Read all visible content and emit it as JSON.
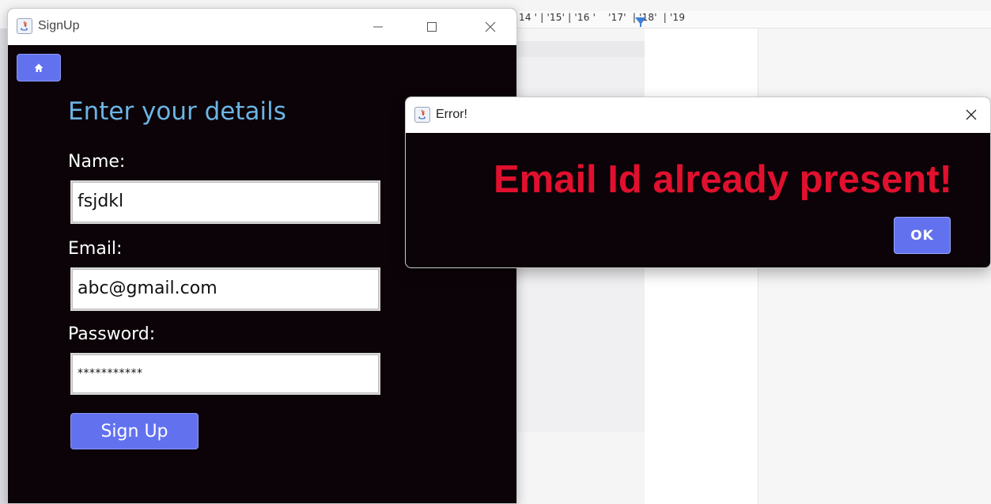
{
  "background": {
    "ruler_numbers": "14 ' | '15' | '16 '    '17'  | '18'  | '19"
  },
  "signup_window": {
    "title": "SignUp",
    "minimize_glyph": "—",
    "maximize_glyph": "☐",
    "close_glyph": "✕",
    "home_icon": "home-icon",
    "heading": "Enter your details",
    "name_label": "Name:",
    "name_value": "fsjdkl",
    "email_label": "Email:",
    "email_value": "abc@gmail.com",
    "password_label": "Password:",
    "password_value": "***********",
    "signup_button": "Sign Up"
  },
  "error_dialog": {
    "title": "Error!",
    "close_glyph": "✕",
    "message": "Email Id already present!",
    "ok_button": "OK",
    "message_color": "#e0102e"
  },
  "colors": {
    "accent": "#6272ef",
    "window_bg": "#0b0307",
    "heading": "#6cb4e4"
  }
}
